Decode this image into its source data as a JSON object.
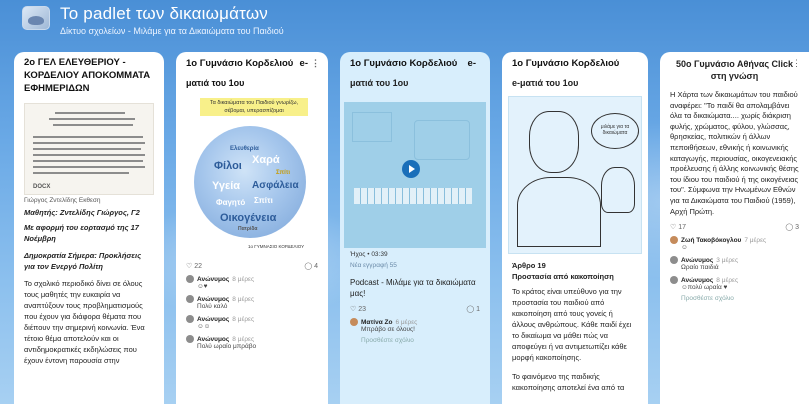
{
  "header": {
    "title": "Το padlet των δικαιωμάτων",
    "subtitle": "Δίκτυο σχολείων - Μιλάμε για τα Δικαιώματα του Παιδιού"
  },
  "col1": {
    "title": "2ο ΓΕΛ ΕΛΕΥΘΕΡΙΟΥ - ΚΟΡΔΕΛΙΟΥ ΑΠΟΚΟΜΜΑΤΑ ΕΦΗΜΕΡΙΔΩΝ",
    "doc_caption": "Γιώργος Ζντελίδης Εκθεση",
    "doc_label": "DOCX",
    "author": "Μαθητής: Ζντελίδης Γιώργος, Γ2",
    "meta": "Με αφορμή του εορτασμό της 17 Νοέμβρη",
    "meta2": "Δημοκρατία Σήμερα: Προκλήσεις για τον Ενεργό Πολίτη",
    "body": "Το σχολικό περιοδικό δίνει σε όλους τους μαθητές την ευκαιρία να αναπτύξουν τους προβληματισμούς που έχουν για διάφορα θέματα που διέπουν την σημερινή κοινωνία. Ένα τέτοιο θέμα αποτελούν και οι αντιδημοκρατικές εκδηλώσεις που έχουν έντονη παρουσία στην"
  },
  "col2": {
    "head": "1ο Γυμνάσιο Κορδελιού",
    "head_right": "e-",
    "sub": "ματιά του 1ου",
    "banner": "Τα δικαιώματα του Παιδιού γνωρίζω, σέβομαι, υπερασπίζομαι",
    "words": [
      "Ελευθερία",
      "Χαρά",
      "Φίλοι",
      "Υγεία",
      "Σπίτι",
      "Ασφάλεια",
      "Φαγητό",
      "Σπίτι",
      "Οικογένεια",
      "Πατρίδα"
    ],
    "poster_caption": "1ο ΓΥΜΝΑΣΙΟ ΚΟΡΔΕΛΙΟΥ",
    "likes": "22",
    "comments": "4",
    "comment_list": [
      {
        "name": "Ανώνυμος",
        "time": "8 μέρες",
        "text": "☺♥"
      },
      {
        "name": "Ανώνυμος",
        "time": "8 μέρες",
        "text": "Πολύ καλό"
      },
      {
        "name": "Ανώνυμος",
        "time": "8 μέρες",
        "text": "☺☺"
      },
      {
        "name": "Ανώνυμος",
        "time": "8 μέρες",
        "text": "Πολύ ωραίο μπράβο"
      }
    ]
  },
  "col3": {
    "head": "1ο Γυμνάσιο Κορδελιού",
    "head_right": "e-",
    "sub": "ματιά του 1ου",
    "audio": "Ήχος • 03:39",
    "meta": "Νέα εγγραφή 55",
    "text": "Podcast - Μιλάμε για τα δικαιώματα μας!",
    "likes": "23",
    "comments": "1",
    "comment": {
      "name": "Ματίνα Ζο",
      "time": "6 μέρες",
      "text": "Μπράβο σε όλους!"
    },
    "add": "Προσθέστε σχόλιο"
  },
  "col4": {
    "head": "1ο Γυμνάσιο Κορδελιού",
    "sub": "e-ματιά του 1ου",
    "bubble": "μιλάμε για τα δικαιώματα",
    "article": "Άρθρο 19",
    "heading": "Προστασία από κακοποίηση",
    "text1": "Το κράτος είναι υπεύθυνο για την προστασία του παιδιού από κακοποίηση από τους γονείς ή άλλους ανθρώπους. Κάθε παιδί έχει το δικαίωμα να μάθει πώς να αποφεύγει ή να αντιμετωπίζει κάθε μορφή κακοποίησης.",
    "text2": "Το φαινόμενο της παιδικής κακοποίησης αποτελεί ένα από τα"
  },
  "col5": {
    "head": "50ο Γυμνάσιο Αθήνας Click στη γνώση",
    "text": "Η Χάρτα των δικαιωμάτων του παιδιού αναφέρει: \"Το παιδί θα απολαμβάνει όλα τα δικαιώματα.... χωρίς διάκριση φυλής, χρώματος, φύλου, γλώσσας, θρησκείας, πολιτικών ή άλλων πεποιθήσεων, εθνικής ή κοινωνικής καταγωγής, περιουσίας, οικογενειακής προέλευσης ή άλλης κοινωνικής θέσης του ίδιου του παιδιού ή της οικογένειας του\". Σύμφωνα την Ηνωμένων Εθνών για τα Δικαιώματα του Παιδιού (1959), Αρχή Πρώτη.",
    "likes": "17",
    "comments": "3",
    "comment_list": [
      {
        "name": "Ζωή Τακοβόκογλου",
        "time": "7 μέρες",
        "text": "☺"
      },
      {
        "name": "Ανώνυμος",
        "time": "3 μέρες",
        "text": "Ωραίο παιδιά"
      },
      {
        "name": "Ανώνυμος",
        "time": "8 μέρες",
        "text": "☺πολύ ωραία ♥"
      }
    ],
    "add": "Προσθέστε σχόλιο"
  }
}
